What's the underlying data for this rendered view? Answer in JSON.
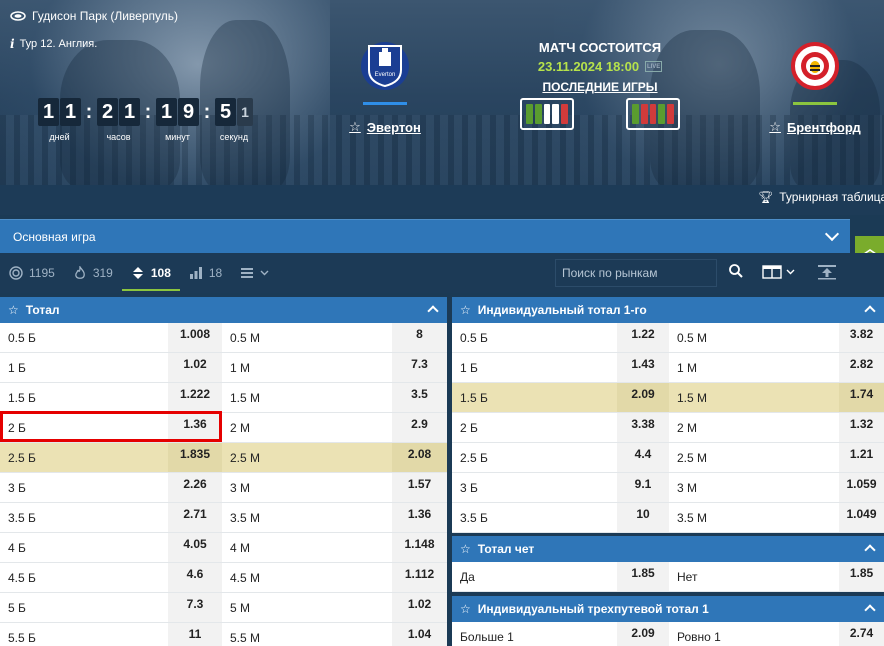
{
  "hero": {
    "venue": "Гудисон Парк (Ливерпуль)",
    "round": "Тур 12. Англия.",
    "countdown": {
      "days": [
        "1",
        "1"
      ],
      "hours": [
        "2",
        "1"
      ],
      "minutes": [
        "1",
        "9"
      ],
      "seconds": [
        "5",
        "1"
      ],
      "labels": {
        "days": "дней",
        "hours": "часов",
        "minutes": "минут",
        "seconds": "секунд"
      }
    },
    "home_team": {
      "name": "Эвертон",
      "bar_color": "#2f8ee8",
      "crest_color": "#1b3e93",
      "crest_text": "Everton"
    },
    "away_team": {
      "name": "Брентфорд",
      "bar_color": "#8bc53f",
      "crest_color": "#d4202a"
    },
    "match_status": "МАТЧ СОСТОИТСЯ",
    "match_date": "23.11.2024 18:00",
    "live_badge": "LIVE",
    "last_games_label": "ПОСЛЕДНИЕ ИГРЫ",
    "home_form": [
      "#5a9c2f",
      "#5a9c2f",
      "#ffffff",
      "#ffffff",
      "#d13b3b"
    ],
    "away_form": [
      "#5a9c2f",
      "#d13b3b",
      "#d13b3b",
      "#5a9c2f",
      "#d13b3b"
    ],
    "standings_label": "Турнирная таблица"
  },
  "main_game": {
    "label": "Основная игра"
  },
  "filters": [
    {
      "icon": "target-icon",
      "count": "1195"
    },
    {
      "icon": "fire-icon",
      "count": "319"
    },
    {
      "icon": "sort-arrows-icon",
      "count": "108",
      "active": true
    },
    {
      "icon": "bars-icon",
      "count": "18"
    }
  ],
  "search": {
    "placeholder": "Поиск по рынкам"
  },
  "colors": {
    "accent": "#2f76b8",
    "highlight": "#ebe2b4",
    "green": "#8bc53f",
    "selected_outline": "#e50000"
  },
  "total": {
    "title": "Тотал",
    "rows": [
      {
        "over": "0.5 Б",
        "over_odd": "1.008",
        "under": "0.5 М",
        "under_odd": "8"
      },
      {
        "over": "1 Б",
        "over_odd": "1.02",
        "under": "1 М",
        "under_odd": "7.3"
      },
      {
        "over": "1.5 Б",
        "over_odd": "1.222",
        "under": "1.5 М",
        "under_odd": "3.5"
      },
      {
        "over": "2 Б",
        "over_odd": "1.36",
        "under": "2 М",
        "under_odd": "2.9",
        "selected": true
      },
      {
        "over": "2.5 Б",
        "over_odd": "1.835",
        "under": "2.5 М",
        "under_odd": "2.08",
        "highlight": true
      },
      {
        "over": "3 Б",
        "over_odd": "2.26",
        "under": "3 М",
        "under_odd": "1.57"
      },
      {
        "over": "3.5 Б",
        "over_odd": "2.71",
        "under": "3.5 М",
        "under_odd": "1.36"
      },
      {
        "over": "4 Б",
        "over_odd": "4.05",
        "under": "4 М",
        "under_odd": "1.148"
      },
      {
        "over": "4.5 Б",
        "over_odd": "4.6",
        "under": "4.5 М",
        "under_odd": "1.112"
      },
      {
        "over": "5 Б",
        "over_odd": "7.3",
        "under": "5 М",
        "under_odd": "1.02"
      },
      {
        "over": "5.5 Б",
        "over_odd": "11",
        "under": "5.5 М",
        "under_odd": "1.04"
      }
    ]
  },
  "ind_total_1": {
    "title": "Индивидуальный тотал 1-го",
    "rows": [
      {
        "over": "0.5 Б",
        "over_odd": "1.22",
        "under": "0.5 М",
        "under_odd": "3.82"
      },
      {
        "over": "1 Б",
        "over_odd": "1.43",
        "under": "1 М",
        "under_odd": "2.82"
      },
      {
        "over": "1.5 Б",
        "over_odd": "2.09",
        "under": "1.5 М",
        "under_odd": "1.74",
        "highlight": true
      },
      {
        "over": "2 Б",
        "over_odd": "3.38",
        "under": "2 М",
        "under_odd": "1.32"
      },
      {
        "over": "2.5 Б",
        "over_odd": "4.4",
        "under": "2.5 М",
        "under_odd": "1.21"
      },
      {
        "over": "3 Б",
        "over_odd": "9.1",
        "under": "3 М",
        "under_odd": "1.059"
      },
      {
        "over": "3.5 Б",
        "over_odd": "10",
        "under": "3.5 М",
        "under_odd": "1.049"
      }
    ]
  },
  "total_even": {
    "title": "Тотал чет",
    "rows": [
      {
        "over": "Да",
        "over_odd": "1.85",
        "under": "Нет",
        "under_odd": "1.85"
      }
    ]
  },
  "ind_3way": {
    "title": "Индивидуальный трехпутевой тотал 1",
    "rows": [
      {
        "over": "Больше 1",
        "over_odd": "2.09",
        "under": "Ровно 1",
        "under_odd": "2.74"
      }
    ]
  }
}
